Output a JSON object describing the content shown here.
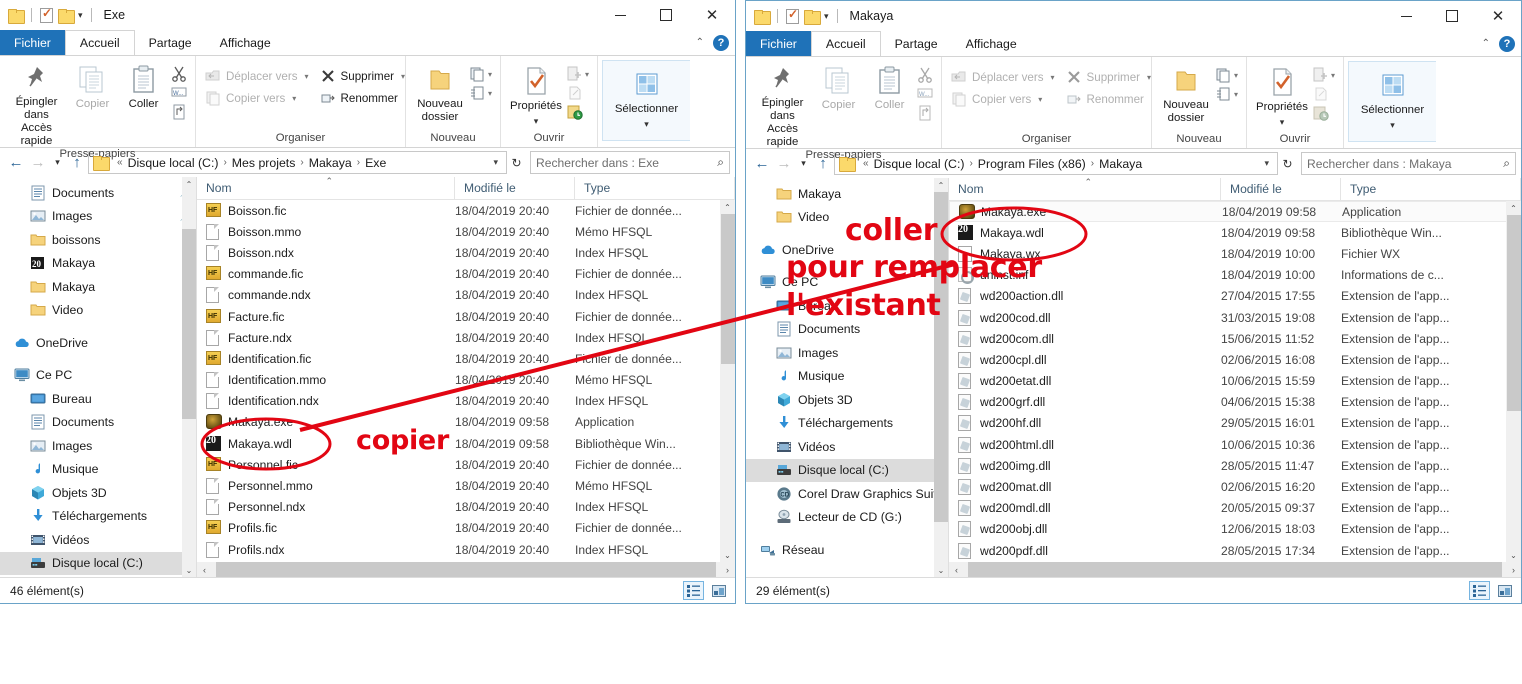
{
  "windows": [
    {
      "id": "left",
      "title": "Exe",
      "tabs": [
        {
          "label": "Fichier",
          "state": "file"
        },
        {
          "label": "Accueil",
          "state": "active"
        },
        {
          "label": "Partage",
          "state": "normal"
        },
        {
          "label": "Affichage",
          "state": "normal"
        }
      ],
      "ribbon": {
        "groups": [
          {
            "label": "Presse-papiers",
            "big": [
              {
                "label": "Épingler dans\nAccès rapide",
                "icon": "pin-icon",
                "dim": false
              },
              {
                "label": "Copier",
                "icon": "copy-icon",
                "dim": true
              },
              {
                "label": "Coller",
                "icon": "paste-icon",
                "dim": false
              }
            ],
            "mini": [
              "cut-icon",
              "copy-path-icon",
              "paste-shortcut-icon"
            ]
          },
          {
            "label": "Organiser",
            "small": [
              {
                "label": "Déplacer vers",
                "icon": "move-to-icon",
                "dim": true,
                "caret": true
              },
              {
                "label": "Copier vers",
                "icon": "copy-to-icon",
                "dim": true,
                "caret": true
              },
              {
                "label": "Supprimer",
                "icon": "delete-icon",
                "dim": false,
                "caret": true
              },
              {
                "label": "Renommer",
                "icon": "rename-icon",
                "dim": false,
                "caret": false
              }
            ]
          },
          {
            "label": "Nouveau",
            "big": [
              {
                "label": "Nouveau\ndossier",
                "icon": "new-folder-icon",
                "dim": false
              }
            ],
            "mini": [
              "new-item-icon",
              "easy-access-icon"
            ]
          },
          {
            "label": "Ouvrir",
            "big": [
              {
                "label": "Propriétés",
                "icon": "properties-icon",
                "dim": false,
                "caret": true
              }
            ],
            "mini": [
              "open-with-icon",
              "edit-icon",
              "history-icon"
            ]
          },
          {
            "label": "",
            "big": [
              {
                "label": "Sélectionner",
                "icon": "select-icon",
                "dim": false,
                "caret": true
              }
            ]
          }
        ]
      },
      "address": {
        "crumbs": [
          "Disque local (C:)",
          "Mes projets",
          "Makaya",
          "Exe"
        ],
        "prefix": "«",
        "search_placeholder": "Rechercher dans : Exe"
      },
      "tree": [
        {
          "label": "Documents",
          "icon": "documents-icon",
          "indent": 1,
          "pinned": true
        },
        {
          "label": "Images",
          "icon": "pictures-icon",
          "indent": 1,
          "pinned": true
        },
        {
          "label": "boissons",
          "icon": "folder-icon",
          "indent": 1,
          "pinned": false
        },
        {
          "label": "Makaya",
          "icon": "wdl-icon",
          "indent": 1,
          "pinned": false
        },
        {
          "label": "Makaya",
          "icon": "folder-icon",
          "indent": 1,
          "pinned": false
        },
        {
          "label": "Video",
          "icon": "folder-icon",
          "indent": 1,
          "pinned": false
        },
        {
          "label": "",
          "icon": "spacer",
          "indent": 0,
          "pinned": false
        },
        {
          "label": "OneDrive",
          "icon": "onedrive-icon",
          "indent": 0,
          "pinned": false
        },
        {
          "label": "",
          "icon": "spacer",
          "indent": 0,
          "pinned": false
        },
        {
          "label": "Ce PC",
          "icon": "thispc-icon",
          "indent": 0,
          "pinned": false
        },
        {
          "label": "Bureau",
          "icon": "desktop-icon",
          "indent": 1,
          "pinned": false
        },
        {
          "label": "Documents",
          "icon": "documents-icon",
          "indent": 1,
          "pinned": false
        },
        {
          "label": "Images",
          "icon": "pictures-icon",
          "indent": 1,
          "pinned": false
        },
        {
          "label": "Musique",
          "icon": "music-icon",
          "indent": 1,
          "pinned": false
        },
        {
          "label": "Objets 3D",
          "icon": "objects3d-icon",
          "indent": 1,
          "pinned": false
        },
        {
          "label": "Téléchargements",
          "icon": "downloads-icon",
          "indent": 1,
          "pinned": false
        },
        {
          "label": "Vidéos",
          "icon": "videos-icon",
          "indent": 1,
          "pinned": false
        },
        {
          "label": "Disque local (C:)",
          "icon": "drive-icon",
          "indent": 1,
          "pinned": false,
          "selected": true
        }
      ],
      "columns": [
        {
          "label": "Nom",
          "sorted": true
        },
        {
          "label": "Modifié le",
          "sorted": false
        },
        {
          "label": "Type",
          "sorted": false
        }
      ],
      "files": [
        {
          "name": "Boisson.fic",
          "modified": "18/04/2019 20:40",
          "type": "Fichier de donnée...",
          "icon": "hfsql-data-icon"
        },
        {
          "name": "Boisson.mmo",
          "modified": "18/04/2019 20:40",
          "type": "Mémo HFSQL",
          "icon": "blank-doc-icon"
        },
        {
          "name": "Boisson.ndx",
          "modified": "18/04/2019 20:40",
          "type": "Index HFSQL",
          "icon": "blank-doc-icon"
        },
        {
          "name": "commande.fic",
          "modified": "18/04/2019 20:40",
          "type": "Fichier de donnée...",
          "icon": "hfsql-data-icon"
        },
        {
          "name": "commande.ndx",
          "modified": "18/04/2019 20:40",
          "type": "Index HFSQL",
          "icon": "blank-doc-icon"
        },
        {
          "name": "Facture.fic",
          "modified": "18/04/2019 20:40",
          "type": "Fichier de donnée...",
          "icon": "hfsql-data-icon"
        },
        {
          "name": "Facture.ndx",
          "modified": "18/04/2019 20:40",
          "type": "Index HFSQL",
          "icon": "blank-doc-icon"
        },
        {
          "name": "Identification.fic",
          "modified": "18/04/2019 20:40",
          "type": "Fichier de donnée...",
          "icon": "hfsql-data-icon"
        },
        {
          "name": "Identification.mmo",
          "modified": "18/04/2019 20:40",
          "type": "Mémo HFSQL",
          "icon": "blank-doc-icon"
        },
        {
          "name": "Identification.ndx",
          "modified": "18/04/2019 20:40",
          "type": "Index HFSQL",
          "icon": "blank-doc-icon"
        },
        {
          "name": "Makaya.exe",
          "modified": "18/04/2019 09:58",
          "type": "Application",
          "icon": "exe-icon"
        },
        {
          "name": "Makaya.wdl",
          "modified": "18/04/2019 09:58",
          "type": "Bibliothèque Win...",
          "icon": "wdl-icon"
        },
        {
          "name": "Personnel.fic",
          "modified": "18/04/2019 20:40",
          "type": "Fichier de donnée...",
          "icon": "hfsql-data-icon"
        },
        {
          "name": "Personnel.mmo",
          "modified": "18/04/2019 20:40",
          "type": "Mémo HFSQL",
          "icon": "blank-doc-icon"
        },
        {
          "name": "Personnel.ndx",
          "modified": "18/04/2019 20:40",
          "type": "Index HFSQL",
          "icon": "blank-doc-icon"
        },
        {
          "name": "Profils.fic",
          "modified": "18/04/2019 20:40",
          "type": "Fichier de donnée...",
          "icon": "hfsql-data-icon"
        },
        {
          "name": "Profils.ndx",
          "modified": "18/04/2019 20:40",
          "type": "Index HFSQL",
          "icon": "blank-doc-icon"
        }
      ],
      "status": "46 élément(s)"
    },
    {
      "id": "right",
      "title": "Makaya",
      "tabs": [
        {
          "label": "Fichier",
          "state": "file"
        },
        {
          "label": "Accueil",
          "state": "active"
        },
        {
          "label": "Partage",
          "state": "normal"
        },
        {
          "label": "Affichage",
          "state": "normal"
        }
      ],
      "address": {
        "crumbs": [
          "Disque local (C:)",
          "Program Files (x86)",
          "Makaya"
        ],
        "prefix": "«",
        "search_placeholder": "Rechercher dans : Makaya"
      },
      "tree": [
        {
          "label": "Makaya",
          "icon": "folder-icon",
          "indent": 1,
          "pinned": false
        },
        {
          "label": "Video",
          "icon": "folder-icon",
          "indent": 1,
          "pinned": false
        },
        {
          "label": "",
          "icon": "spacer",
          "indent": 0,
          "pinned": false
        },
        {
          "label": "OneDrive",
          "icon": "onedrive-icon",
          "indent": 0,
          "pinned": false
        },
        {
          "label": "",
          "icon": "spacer",
          "indent": 0,
          "pinned": false
        },
        {
          "label": "Ce PC",
          "icon": "thispc-icon",
          "indent": 0,
          "pinned": false
        },
        {
          "label": "Bureau",
          "icon": "desktop-icon",
          "indent": 1,
          "pinned": false
        },
        {
          "label": "Documents",
          "icon": "documents-icon",
          "indent": 1,
          "pinned": false
        },
        {
          "label": "Images",
          "icon": "pictures-icon",
          "indent": 1,
          "pinned": false
        },
        {
          "label": "Musique",
          "icon": "music-icon",
          "indent": 1,
          "pinned": false
        },
        {
          "label": "Objets 3D",
          "icon": "objects3d-icon",
          "indent": 1,
          "pinned": false
        },
        {
          "label": "Téléchargements",
          "icon": "downloads-icon",
          "indent": 1,
          "pinned": false
        },
        {
          "label": "Vidéos",
          "icon": "videos-icon",
          "indent": 1,
          "pinned": false
        },
        {
          "label": "Disque local (C:)",
          "icon": "drive-icon",
          "indent": 1,
          "pinned": false,
          "selected": true
        },
        {
          "label": "Corel Draw Graphics Suite",
          "icon": "corel-icon",
          "indent": 1,
          "pinned": false
        },
        {
          "label": "Lecteur de CD (G:)",
          "icon": "cd-icon",
          "indent": 1,
          "pinned": false
        },
        {
          "label": "",
          "icon": "spacer",
          "indent": 0,
          "pinned": false
        },
        {
          "label": "Réseau",
          "icon": "network-icon",
          "indent": 0,
          "pinned": false
        }
      ],
      "columns": [
        {
          "label": "Nom",
          "sorted": true
        },
        {
          "label": "Modifié le",
          "sorted": false
        },
        {
          "label": "Type",
          "sorted": false
        }
      ],
      "files": [
        {
          "name": "Makaya.exe",
          "modified": "18/04/2019 09:58",
          "type": "Application",
          "icon": "exe-icon",
          "highlight": true
        },
        {
          "name": "Makaya.wdl",
          "modified": "18/04/2019 09:58",
          "type": "Bibliothèque Win...",
          "icon": "wdl-icon"
        },
        {
          "name": "Makaya.wx",
          "modified": "18/04/2019 10:00",
          "type": "Fichier WX",
          "icon": "wx-icon"
        },
        {
          "name": "uninst.inf",
          "modified": "18/04/2019 10:00",
          "type": "Informations de c...",
          "icon": "inf-icon"
        },
        {
          "name": "wd200action.dll",
          "modified": "27/04/2015 17:55",
          "type": "Extension de l'app...",
          "icon": "dll-icon"
        },
        {
          "name": "wd200cod.dll",
          "modified": "31/03/2015 19:08",
          "type": "Extension de l'app...",
          "icon": "dll-icon"
        },
        {
          "name": "wd200com.dll",
          "modified": "15/06/2015 11:52",
          "type": "Extension de l'app...",
          "icon": "dll-icon"
        },
        {
          "name": "wd200cpl.dll",
          "modified": "02/06/2015 16:08",
          "type": "Extension de l'app...",
          "icon": "dll-icon"
        },
        {
          "name": "wd200etat.dll",
          "modified": "10/06/2015 15:59",
          "type": "Extension de l'app...",
          "icon": "dll-icon"
        },
        {
          "name": "wd200grf.dll",
          "modified": "04/06/2015 15:38",
          "type": "Extension de l'app...",
          "icon": "dll-icon"
        },
        {
          "name": "wd200hf.dll",
          "modified": "29/05/2015 16:01",
          "type": "Extension de l'app...",
          "icon": "dll-icon"
        },
        {
          "name": "wd200html.dll",
          "modified": "10/06/2015 10:36",
          "type": "Extension de l'app...",
          "icon": "dll-icon"
        },
        {
          "name": "wd200img.dll",
          "modified": "28/05/2015 11:47",
          "type": "Extension de l'app...",
          "icon": "dll-icon"
        },
        {
          "name": "wd200mat.dll",
          "modified": "02/06/2015 16:20",
          "type": "Extension de l'app...",
          "icon": "dll-icon"
        },
        {
          "name": "wd200mdl.dll",
          "modified": "20/05/2015 09:37",
          "type": "Extension de l'app...",
          "icon": "dll-icon"
        },
        {
          "name": "wd200obj.dll",
          "modified": "12/06/2015 18:03",
          "type": "Extension de l'app...",
          "icon": "dll-icon"
        },
        {
          "name": "wd200pdf.dll",
          "modified": "28/05/2015 17:34",
          "type": "Extension de l'app...",
          "icon": "dll-icon"
        }
      ],
      "status": "29 élément(s)"
    }
  ],
  "annotations": {
    "color": "#e20613",
    "copier": "copier",
    "coller": "coller",
    "pour_remplacer": "pour remplacer",
    "lexistant": "l'existant"
  }
}
